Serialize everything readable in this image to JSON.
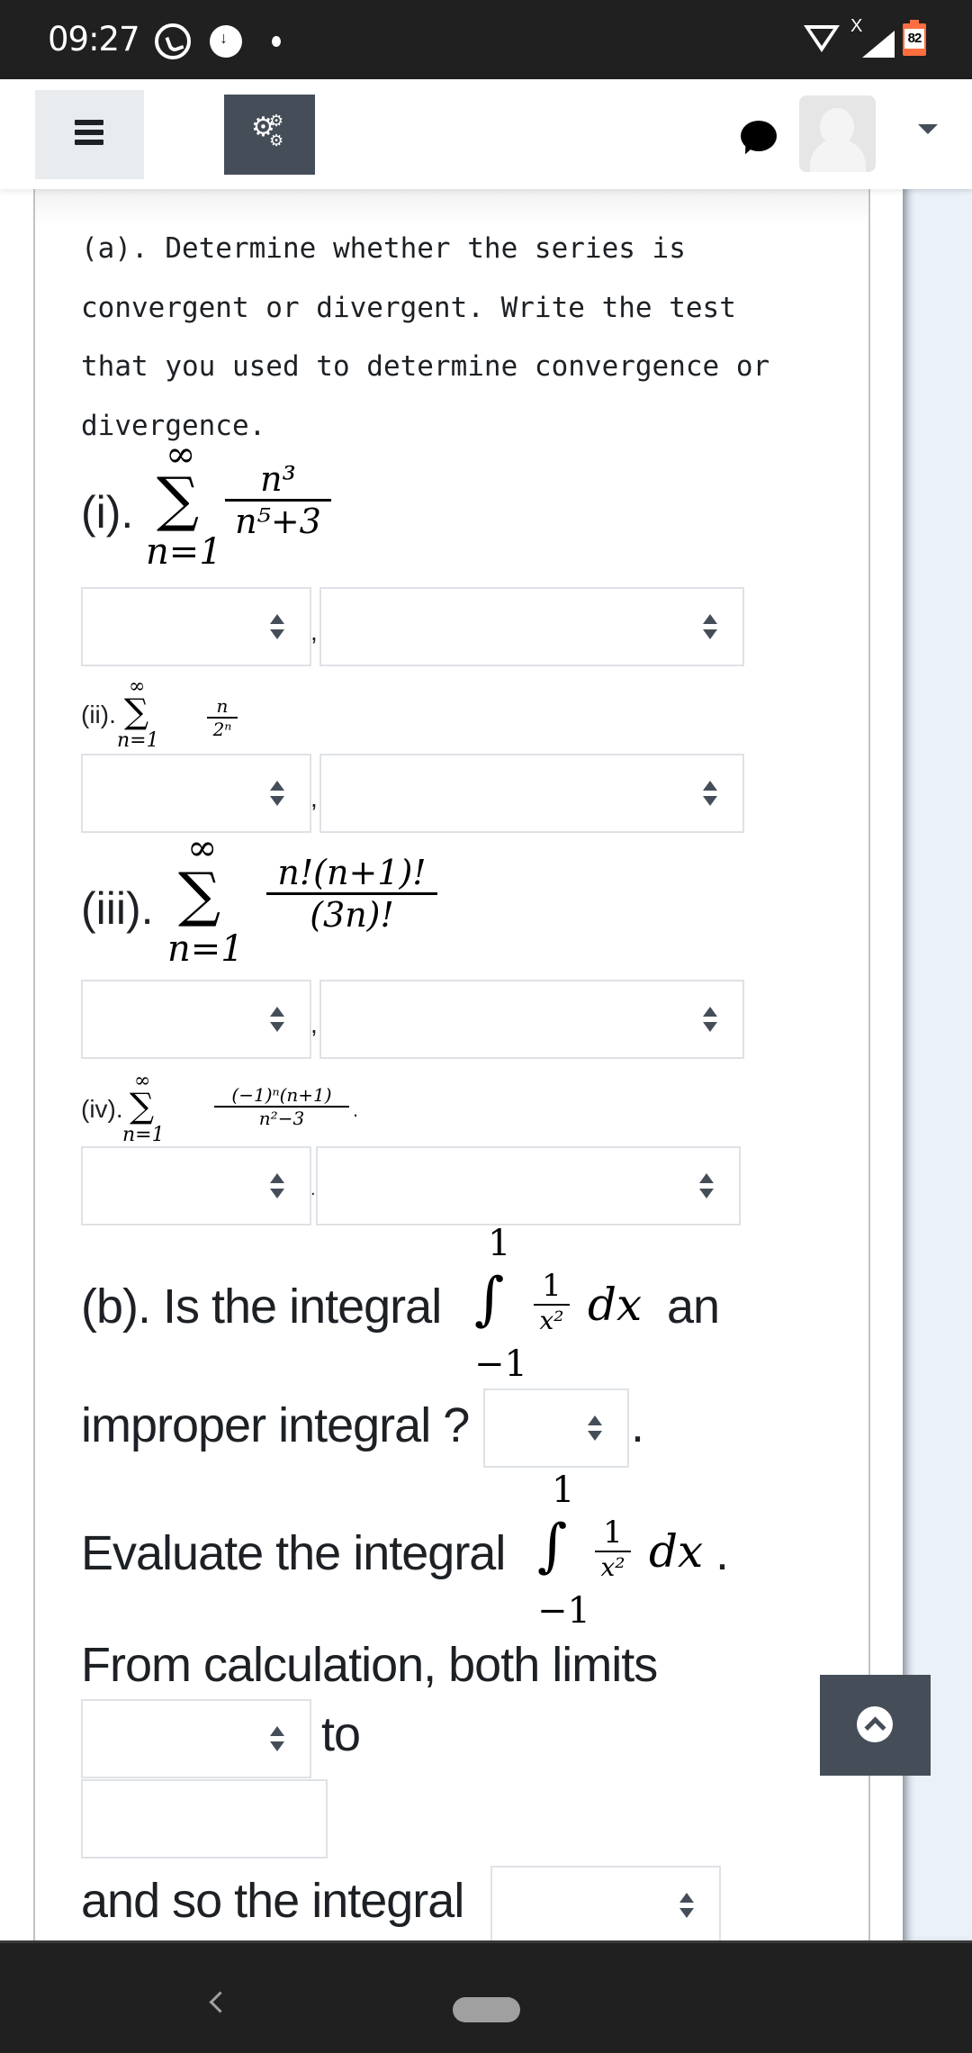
{
  "status_bar": {
    "time": "09:27",
    "icons": [
      "whatsapp-icon",
      "download-icon",
      "dot-icon",
      "wifi-icon",
      "signal-icon",
      "battery-icon"
    ],
    "signal_marker": "X",
    "battery_level": "82",
    "battery_color": "#ff6e40"
  },
  "header": {
    "menu_icon": "hamburger-icon",
    "settings_icon": "gears-icon",
    "chat_icon": "speech-bubble-icon",
    "avatar_icon": "user-avatar",
    "dropdown_icon": "caret-down-icon",
    "accent_color": "#454e58"
  },
  "question": {
    "part_a_intro": [
      "(a). Determine whether the series is",
      "convergent or divergent. Write the test",
      "that you used to determine convergence or",
      "divergence."
    ],
    "series": [
      {
        "label": "(i).",
        "upper": "∞",
        "lower": "n=1",
        "numerator": "n³",
        "denominator": "n⁵+3",
        "trailing": "",
        "answer_select": "",
        "test_select": ""
      },
      {
        "label": "(ii).",
        "upper": "∞",
        "lower": "n=1",
        "numerator": "n",
        "denominator": "2ⁿ",
        "trailing": "",
        "answer_select": "",
        "test_select": ""
      },
      {
        "label": "(iii).",
        "upper": "∞",
        "lower": "n=1",
        "numerator": "n!(n+1)!",
        "denominator": "(3n)!",
        "trailing": "",
        "answer_select": "",
        "test_select": ""
      },
      {
        "label": "(iv).",
        "upper": "∞",
        "lower": "n=1",
        "numerator": "(−1)ⁿ(n+1)",
        "denominator": "n²−3",
        "trailing": ".",
        "answer_select": "",
        "test_select": ""
      }
    ],
    "separator": ",",
    "part_b": {
      "prefix": "(b). Is the integral",
      "integral_upper": "1",
      "integral_lower": "−1",
      "integrand_num": "1",
      "integrand_den": "x²",
      "differential": "dx",
      "suffix": "an",
      "line2": "improper integral ?",
      "line2_end": ".",
      "improper_select": "",
      "evaluate_prefix": "Evaluate the integral",
      "evaluate_suffix": ".",
      "from_calc": "From calculation, both limits",
      "limits_select": "",
      "to_word": "to",
      "limit_value_input": "",
      "and_so": "and so the integral",
      "result_select": ""
    }
  },
  "back_to_top_icon": "chevron-up-circle-icon",
  "nav_bar": {
    "back_icon": "back-chevron-icon",
    "home_icon": "home-pill-icon"
  }
}
